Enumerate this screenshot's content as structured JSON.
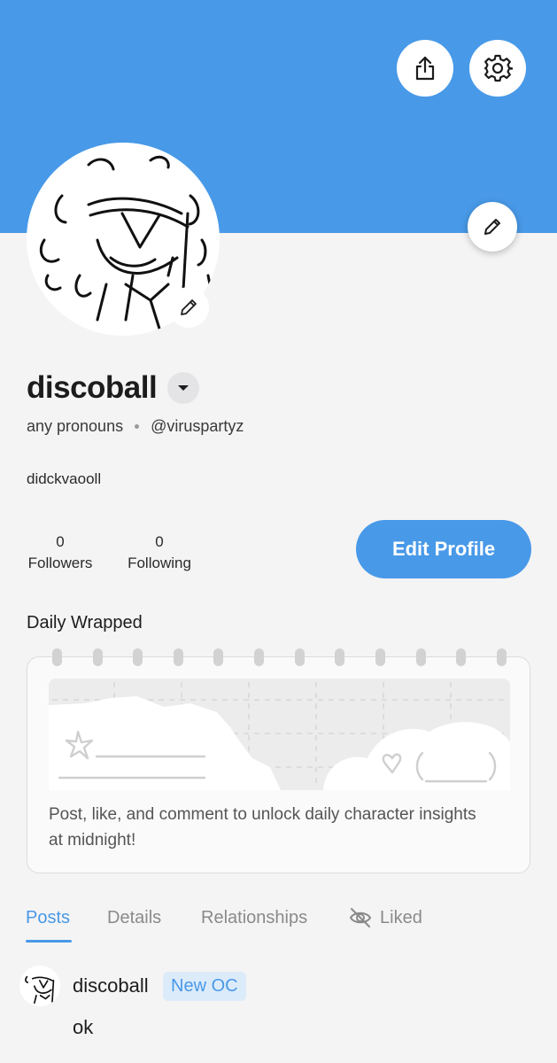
{
  "header": {
    "share_icon": "share-icon",
    "settings_icon": "gear-icon",
    "edit_banner_icon": "pencil-icon",
    "banner_color": "#4899e8"
  },
  "profile": {
    "display_name": "discoball",
    "pronouns": "any pronouns",
    "handle": "@viruspartyz",
    "bio": "didckvaooll",
    "followers_count": "0",
    "followers_label": "Followers",
    "following_count": "0",
    "following_label": "Following",
    "edit_profile_label": "Edit Profile"
  },
  "daily_wrapped": {
    "title": "Daily Wrapped",
    "message": "Post, like, and comment to unlock daily character insights at midnight!"
  },
  "tabs": [
    {
      "label": "Posts",
      "active": true
    },
    {
      "label": "Details",
      "active": false
    },
    {
      "label": "Relationships",
      "active": false
    },
    {
      "label": "Liked",
      "active": false,
      "icon": "eye-off-icon"
    }
  ],
  "posts": [
    {
      "author": "discoball",
      "tag": "New OC",
      "body": "ok"
    }
  ],
  "colors": {
    "accent": "#4899e8",
    "tag_background": "#dcebfa",
    "page_background": "#f4f4f4"
  }
}
